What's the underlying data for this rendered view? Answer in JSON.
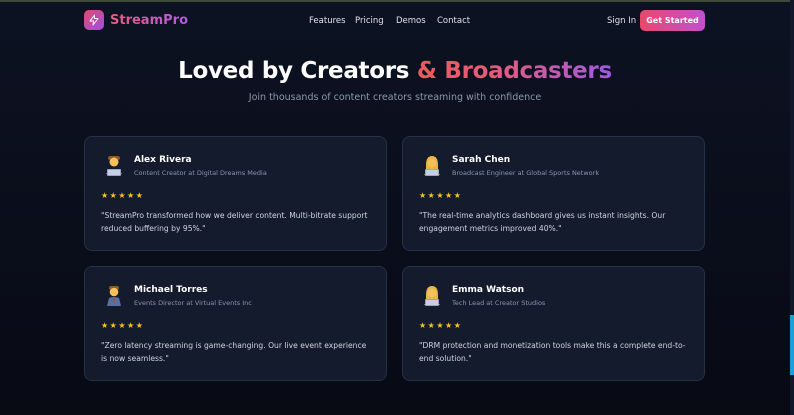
{
  "brand": {
    "name": "StreamPro",
    "accent_from": "#e6496b",
    "accent_to": "#a14de2"
  },
  "nav": {
    "links": [
      "Features",
      "Pricing",
      "Demos",
      "Contact"
    ],
    "sign_in": "Sign In",
    "cta": "Get Started"
  },
  "hero": {
    "title_main": "Loved by Creators ",
    "title_accent": "& Broadcasters",
    "subtitle": "Join thousands of content creators streaming with confidence"
  },
  "testimonials": [
    {
      "name": "Alex Rivera",
      "role": "Content Creator at Digital Dreams Media",
      "stars": "★★★★★",
      "rating": 5,
      "quote": "\"StreamPro transformed how we deliver content. Multi-bitrate support reduced buffering by 95%.\"",
      "avatar_icon": "man-technologist-icon"
    },
    {
      "name": "Sarah Chen",
      "role": "Broadcast Engineer at Global Sports Network",
      "stars": "★★★★★",
      "rating": 5,
      "quote": "\"The real-time analytics dashboard gives us instant insights. Our engagement metrics improved 40%.\"",
      "avatar_icon": "woman-technologist-icon"
    },
    {
      "name": "Michael Torres",
      "role": "Events Director at Virtual Events Inc",
      "stars": "★★★★★",
      "rating": 5,
      "quote": "\"Zero latency streaming is game-changing. Our live event experience is now seamless.\"",
      "avatar_icon": "man-office-worker-icon"
    },
    {
      "name": "Emma Watson",
      "role": "Tech Lead at Creator Studios",
      "stars": "★★★★★",
      "rating": 5,
      "quote": "\"DRM protection and monetization tools make this a complete end-to-end solution.\"",
      "avatar_icon": "woman-technologist-icon"
    }
  ]
}
